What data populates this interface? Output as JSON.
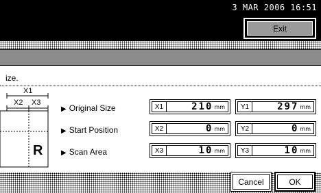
{
  "header": {
    "datetime": "3  MAR  2006 16:51",
    "exit_label": "Exit"
  },
  "instruction": "ize.",
  "diagram": {
    "labels": [
      "X1",
      "X2",
      "X3"
    ],
    "sample_letter": "R"
  },
  "rows": [
    {
      "label": "Original Size",
      "fields": [
        {
          "tag": "X1",
          "value": "210",
          "unit": "mm"
        },
        {
          "tag": "Y1",
          "value": "297",
          "unit": "mm"
        }
      ]
    },
    {
      "label": "Start Position",
      "fields": [
        {
          "tag": "X2",
          "value": "0",
          "unit": "mm"
        },
        {
          "tag": "Y2",
          "value": "0",
          "unit": "mm"
        }
      ]
    },
    {
      "label": "Scan Area",
      "fields": [
        {
          "tag": "X3",
          "value": "10",
          "unit": "mm"
        },
        {
          "tag": "Y3",
          "value": "10",
          "unit": "mm"
        }
      ]
    }
  ],
  "buttons": {
    "cancel": "Cancel",
    "ok": "OK"
  }
}
